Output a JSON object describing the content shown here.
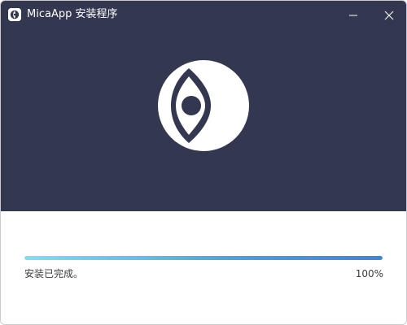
{
  "window": {
    "title": "MicaApp 安装程序",
    "app_icon": "micaapp-logo-icon",
    "controls": {
      "minimize_icon": "minimize-icon",
      "close_icon": "close-icon"
    }
  },
  "hero": {
    "logo": "micaapp-eye-moon-logo",
    "background_color": "#33374f"
  },
  "install": {
    "status": "安装已完成。",
    "progress_percent": 100,
    "progress_label": "100%"
  },
  "colors": {
    "progress_start": "#7fe0ee",
    "progress_end": "#3a86d8"
  }
}
